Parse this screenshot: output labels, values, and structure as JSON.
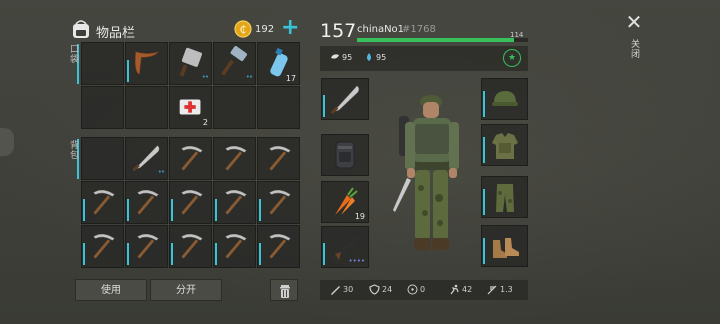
{
  "header": {
    "title": "物品栏",
    "coins": "192",
    "add_label": "+"
  },
  "side_labels": {
    "pocket": "口袋",
    "backpack": "背包"
  },
  "pocket_slots": [
    {
      "icon": "empty"
    },
    {
      "icon": "boomerang-icon",
      "durability": true
    },
    {
      "icon": "cleaver-icon",
      "dots": "••"
    },
    {
      "icon": "hammer-icon",
      "dots": "••"
    },
    {
      "icon": "water-bottle-icon",
      "qty": "17"
    },
    {
      "icon": "empty"
    },
    {
      "icon": "empty"
    },
    {
      "icon": "medkit-icon",
      "qty": "2"
    },
    {
      "icon": "empty"
    },
    {
      "icon": "empty"
    }
  ],
  "backpack_slots": [
    {
      "icon": "empty"
    },
    {
      "icon": "machete-icon",
      "dots": "••"
    },
    {
      "icon": "pickaxe-icon"
    },
    {
      "icon": "pickaxe-icon"
    },
    {
      "icon": "pickaxe-icon"
    },
    {
      "icon": "pickaxe-icon",
      "durability": true
    },
    {
      "icon": "pickaxe-icon",
      "durability": true
    },
    {
      "icon": "pickaxe-icon",
      "durability": true
    },
    {
      "icon": "pickaxe-icon",
      "durability": true
    },
    {
      "icon": "pickaxe-icon",
      "durability": true
    },
    {
      "icon": "pickaxe-icon",
      "durability": true
    },
    {
      "icon": "pickaxe-icon",
      "durability": true
    },
    {
      "icon": "pickaxe-icon",
      "durability": true
    },
    {
      "icon": "pickaxe-icon",
      "durability": true
    },
    {
      "icon": "pickaxe-icon",
      "durability": true
    }
  ],
  "buttons": {
    "use": "使用",
    "split": "分开",
    "trash_icon": "trash-icon"
  },
  "player": {
    "level": "157",
    "name": "chinaNo1",
    "id": "#1768",
    "xp_value": "114",
    "xp_fraction": 0.92,
    "hunger": "95",
    "thirst": "95"
  },
  "equipment": {
    "quick_slots": [
      {
        "icon": "machete-icon"
      },
      {
        "icon": "backpack-icon"
      },
      {
        "icon": "carrot-icon",
        "qty": "19"
      },
      {
        "icon": "rifle-icon",
        "dots": "••••"
      }
    ],
    "armor_slots": [
      {
        "icon": "helmet-icon"
      },
      {
        "icon": "vest-icon"
      },
      {
        "icon": "pants-icon"
      },
      {
        "icon": "boots-icon"
      }
    ]
  },
  "bottom_stats": [
    {
      "icon": "damage-icon",
      "value": "30"
    },
    {
      "icon": "armor-icon",
      "value": "24"
    },
    {
      "icon": "radiation-icon",
      "value": "0"
    },
    {
      "icon": "speed-icon",
      "value": "42"
    },
    {
      "icon": "attack-speed-icon",
      "value": "1.3"
    }
  ],
  "close": {
    "icon": "close-icon",
    "label": "关闭"
  },
  "colors": {
    "accent": "#39c3d9",
    "xp": "#38c05a",
    "panel": "#262624"
  }
}
